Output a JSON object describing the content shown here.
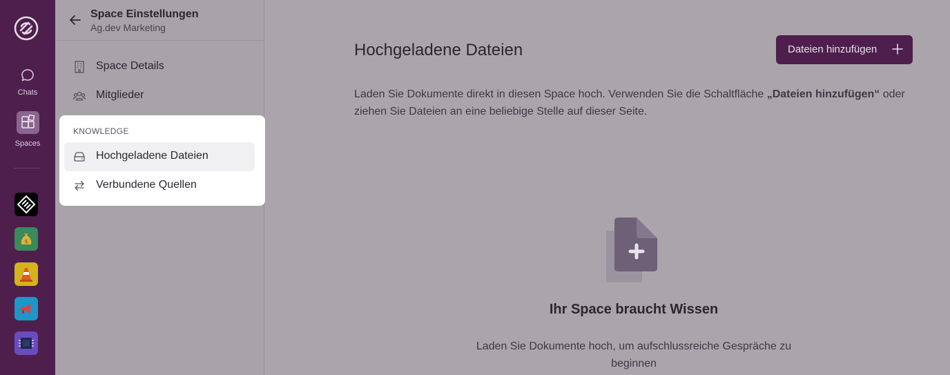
{
  "rail": {
    "nav": [
      {
        "label": "Chats",
        "icon": "chat-bubble-icon"
      },
      {
        "label": "Spaces",
        "icon": "spaces-icon"
      }
    ],
    "spaces": [
      {
        "icon": "diamond-logo-icon",
        "color": "#000000"
      },
      {
        "icon": "money-bag-icon",
        "color": "#3a8a5a"
      },
      {
        "icon": "traffic-cone-icon",
        "color": "#d4b41c"
      },
      {
        "icon": "megaphone-icon",
        "color": "#1e96c8"
      },
      {
        "icon": "chip-icon",
        "color": "#6a4cc0"
      }
    ]
  },
  "sidebar": {
    "title": "Space Einstellungen",
    "subtitle": "Ag.dev Marketing",
    "items": [
      {
        "label": "Space Details",
        "icon": "building-icon"
      },
      {
        "label": "Mitglieder",
        "icon": "members-icon"
      }
    ],
    "knowledge": {
      "heading": "KNOWLEDGE",
      "items": [
        {
          "label": "Hochgeladene Dateien",
          "icon": "drive-icon",
          "active": true
        },
        {
          "label": "Verbundene Quellen",
          "icon": "arrows-swap-icon",
          "active": false
        }
      ]
    }
  },
  "main": {
    "title": "Hochgeladene Dateien",
    "add_button": "Dateien hinzufügen",
    "description_part1": "Laden Sie Dokumente direkt in diesen Space hoch. Verwenden Sie die Schaltfläche ",
    "description_button": "„Dateien hinzufügen“",
    "description_part2": " oder ziehen Sie Dateien an eine beliebige Stelle auf dieser Seite.",
    "empty_title": "Ihr Space braucht Wissen",
    "empty_text": "Laden Sie Dokumente hoch, um aufschlussreiche Gespräche zu beginnen"
  },
  "colors": {
    "brand": "#4e1f4d",
    "overlay": "#aaa5ab"
  }
}
